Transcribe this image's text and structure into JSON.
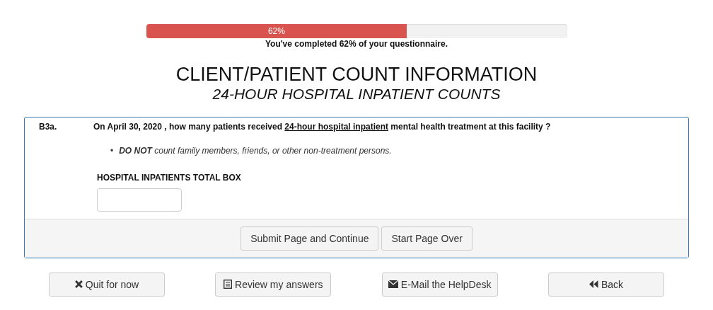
{
  "progress": {
    "level": 0.62,
    "label": "62%",
    "caption": "You've completed 62% of your questionnaire."
  },
  "heading": {
    "title": "CLIENT/PATIENT COUNT INFORMATION",
    "subtitle": "24-HOUR HOSPITAL INPATIENT COUNTS"
  },
  "question": {
    "number": "B3a.",
    "text_before": "On April 30, 2020 , how many patients received",
    "link": "24-hour hospital inpatient",
    "text_after": "mental health treatment at  this facility  ?",
    "bullets": [
      {
        "marker": "•",
        "text": "**DO NOT** count family members, friends, or other non-treatment persons."
      }
    ],
    "field_label": "HOSPITAL INPATIENTS TOTAL BOX"
  },
  "form_buttons": [
    "Submit Page and Continue",
    "Start Page Over"
  ],
  "nav_buttons": [
    {
      "kind": "quit",
      "label": "Quit for now"
    },
    {
      "kind": "review",
      "label": "Review my answers"
    },
    {
      "kind": "email",
      "label": "E-Mail the HelpDesk"
    },
    {
      "kind": "back",
      "label": "Back"
    }
  ]
}
